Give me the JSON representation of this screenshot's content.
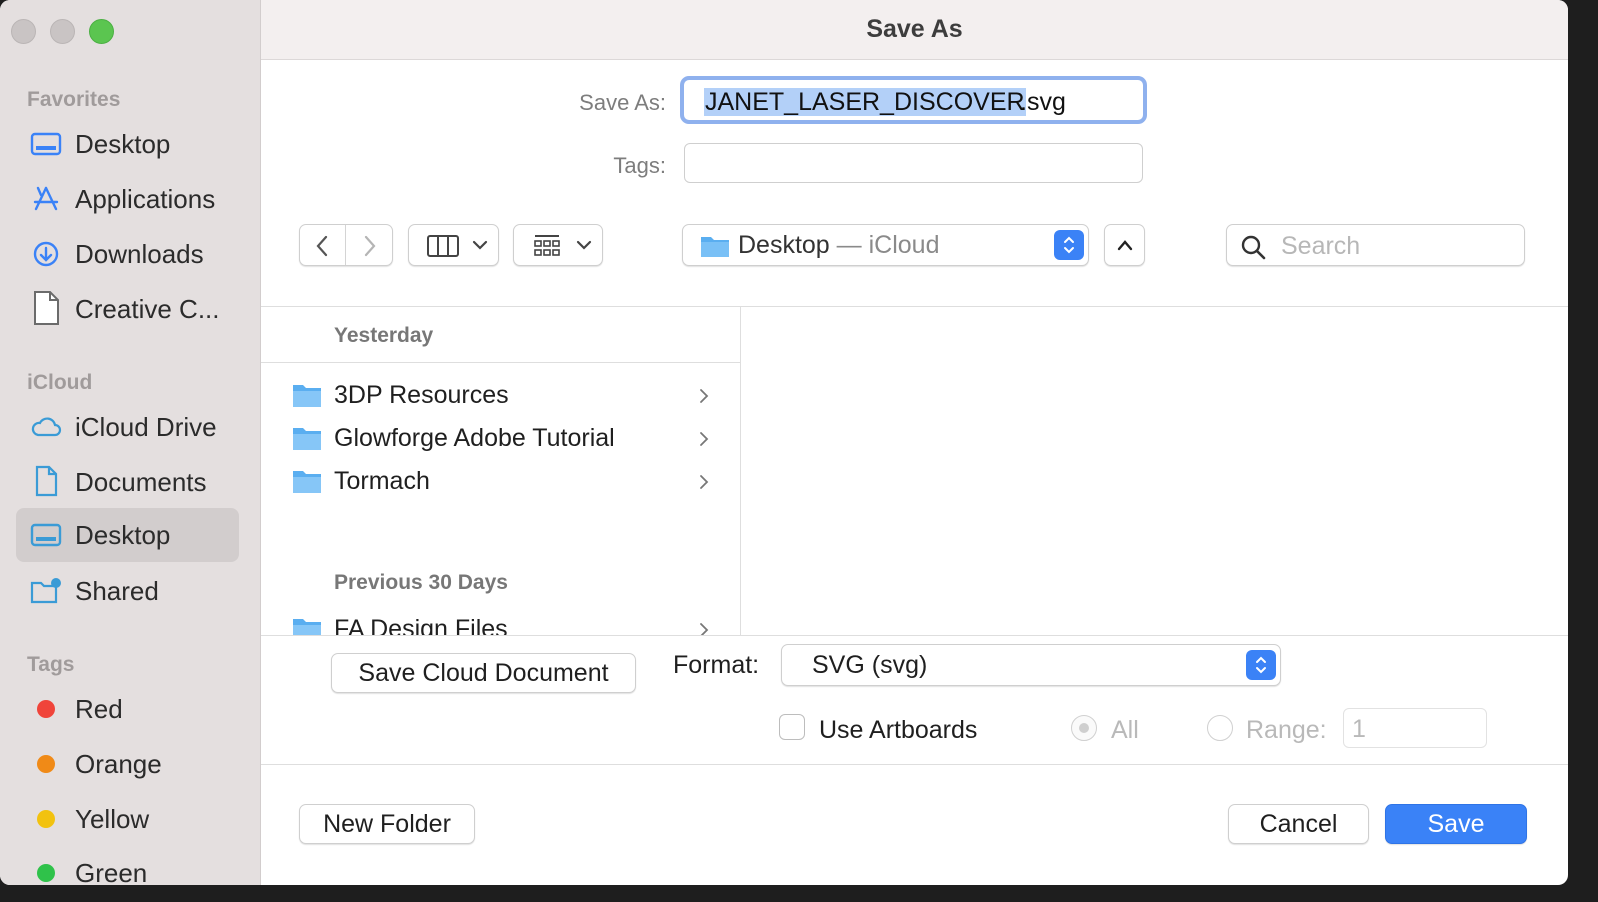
{
  "window": {
    "title": "Save As"
  },
  "sidebar": {
    "favorites_header": "Favorites",
    "favorites": [
      {
        "label": "Desktop",
        "icon": "desktop-icon"
      },
      {
        "label": "Applications",
        "icon": "applications-icon"
      },
      {
        "label": "Downloads",
        "icon": "downloads-icon"
      },
      {
        "label": "Creative C...",
        "icon": "document-icon"
      }
    ],
    "icloud_header": "iCloud",
    "icloud": [
      {
        "label": "iCloud Drive",
        "icon": "cloud-icon"
      },
      {
        "label": "Documents",
        "icon": "document-icon"
      },
      {
        "label": "Desktop",
        "icon": "desktop-icon",
        "selected": true
      },
      {
        "label": "Shared",
        "icon": "shared-folder-icon"
      }
    ],
    "tags_header": "Tags",
    "tags": [
      {
        "label": "Red",
        "color": "#f0443a"
      },
      {
        "label": "Orange",
        "color": "#f08a17"
      },
      {
        "label": "Yellow",
        "color": "#f2c20f"
      },
      {
        "label": "Green",
        "color": "#2fc24a"
      }
    ]
  },
  "form": {
    "save_as_label": "Save As:",
    "filename_selected": "JANET_LASER_DISCOVER",
    "filename_ext": ".svg",
    "tags_label": "Tags:",
    "tags_value": ""
  },
  "toolbar": {
    "location_folder": "Desktop",
    "location_suffix": " — iCloud",
    "search_placeholder": "Search"
  },
  "browser": {
    "groups": [
      {
        "label": "Yesterday",
        "items": [
          "3DP Resources",
          "Glowforge Adobe Tutorial",
          "Tormach"
        ]
      },
      {
        "label": "Previous 30 Days",
        "items": [
          "FA Design Files"
        ]
      }
    ]
  },
  "options": {
    "save_cloud_label": "Save Cloud Document",
    "format_label": "Format:",
    "format_value": "SVG (svg)",
    "use_artboards_label": "Use Artboards",
    "all_label": "All",
    "range_label": "Range:",
    "range_value": "1"
  },
  "footer": {
    "new_folder_label": "New Folder",
    "cancel_label": "Cancel",
    "save_label": "Save"
  },
  "colors": {
    "accent": "#3a82f7",
    "selection": "#b3d0f8"
  }
}
